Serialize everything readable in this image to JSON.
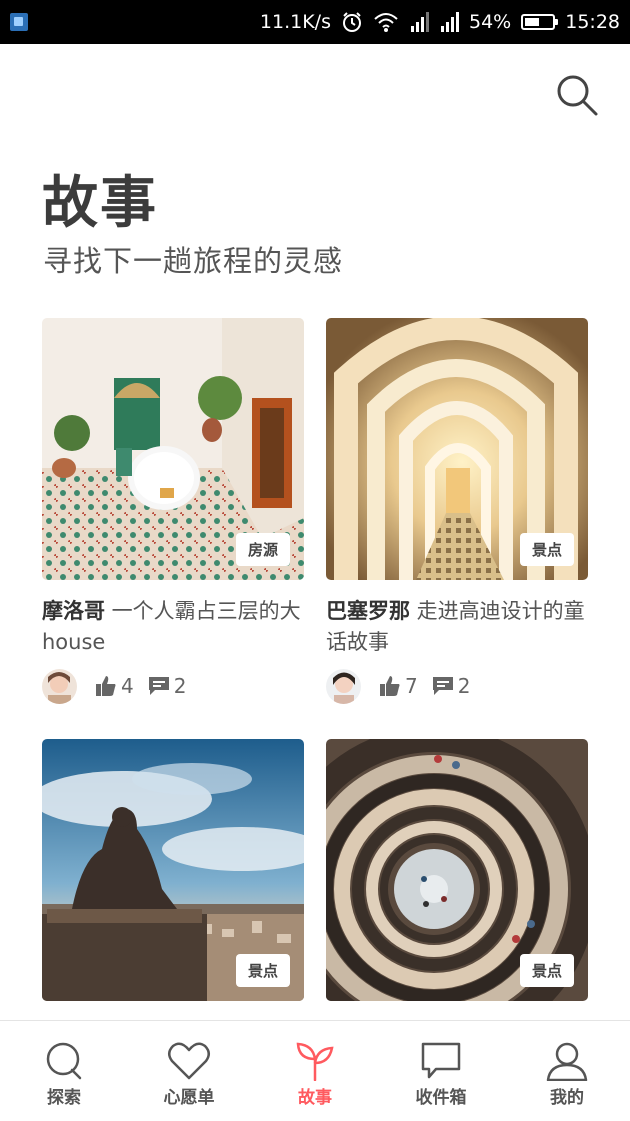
{
  "status_bar": {
    "speed": "11.1K/s",
    "battery": "54%",
    "battery_level": 0.54,
    "time": "15:28"
  },
  "header": {
    "title": "故事",
    "subtitle": "寻找下一趟旅程的灵感"
  },
  "cards": [
    {
      "location": "摩洛哥",
      "title": " 一个人霸占三层的大house",
      "tag": "房源",
      "likes": "4",
      "comments": "2"
    },
    {
      "location": "巴塞罗那",
      "title": " 走进高迪设计的童话故事",
      "tag": "景点",
      "likes": "7",
      "comments": "2"
    },
    {
      "tag": "景点"
    },
    {
      "tag": "景点"
    }
  ],
  "tabs": [
    {
      "label": "探索",
      "icon": "search-icon"
    },
    {
      "label": "心愿单",
      "icon": "heart-icon"
    },
    {
      "label": "故事",
      "icon": "sprout-icon",
      "active": true
    },
    {
      "label": "收件箱",
      "icon": "chat-bubble-icon"
    },
    {
      "label": "我的",
      "icon": "person-icon"
    }
  ],
  "colors": {
    "accent": "#ff5a5f",
    "status_bar": "#000000"
  }
}
